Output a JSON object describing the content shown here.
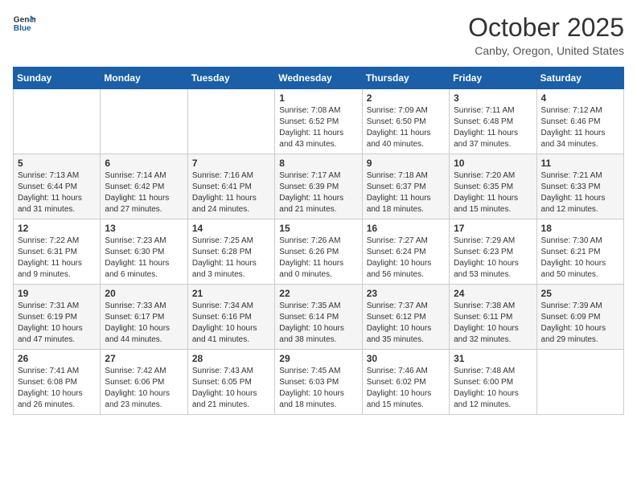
{
  "header": {
    "logo_general": "General",
    "logo_blue": "Blue",
    "title": "October 2025",
    "location": "Canby, Oregon, United States"
  },
  "weekdays": [
    "Sunday",
    "Monday",
    "Tuesday",
    "Wednesday",
    "Thursday",
    "Friday",
    "Saturday"
  ],
  "weeks": [
    [
      {
        "day": "",
        "info": ""
      },
      {
        "day": "",
        "info": ""
      },
      {
        "day": "",
        "info": ""
      },
      {
        "day": "1",
        "info": "Sunrise: 7:08 AM\nSunset: 6:52 PM\nDaylight: 11 hours\nand 43 minutes."
      },
      {
        "day": "2",
        "info": "Sunrise: 7:09 AM\nSunset: 6:50 PM\nDaylight: 11 hours\nand 40 minutes."
      },
      {
        "day": "3",
        "info": "Sunrise: 7:11 AM\nSunset: 6:48 PM\nDaylight: 11 hours\nand 37 minutes."
      },
      {
        "day": "4",
        "info": "Sunrise: 7:12 AM\nSunset: 6:46 PM\nDaylight: 11 hours\nand 34 minutes."
      }
    ],
    [
      {
        "day": "5",
        "info": "Sunrise: 7:13 AM\nSunset: 6:44 PM\nDaylight: 11 hours\nand 31 minutes."
      },
      {
        "day": "6",
        "info": "Sunrise: 7:14 AM\nSunset: 6:42 PM\nDaylight: 11 hours\nand 27 minutes."
      },
      {
        "day": "7",
        "info": "Sunrise: 7:16 AM\nSunset: 6:41 PM\nDaylight: 11 hours\nand 24 minutes."
      },
      {
        "day": "8",
        "info": "Sunrise: 7:17 AM\nSunset: 6:39 PM\nDaylight: 11 hours\nand 21 minutes."
      },
      {
        "day": "9",
        "info": "Sunrise: 7:18 AM\nSunset: 6:37 PM\nDaylight: 11 hours\nand 18 minutes."
      },
      {
        "day": "10",
        "info": "Sunrise: 7:20 AM\nSunset: 6:35 PM\nDaylight: 11 hours\nand 15 minutes."
      },
      {
        "day": "11",
        "info": "Sunrise: 7:21 AM\nSunset: 6:33 PM\nDaylight: 11 hours\nand 12 minutes."
      }
    ],
    [
      {
        "day": "12",
        "info": "Sunrise: 7:22 AM\nSunset: 6:31 PM\nDaylight: 11 hours\nand 9 minutes."
      },
      {
        "day": "13",
        "info": "Sunrise: 7:23 AM\nSunset: 6:30 PM\nDaylight: 11 hours\nand 6 minutes."
      },
      {
        "day": "14",
        "info": "Sunrise: 7:25 AM\nSunset: 6:28 PM\nDaylight: 11 hours\nand 3 minutes."
      },
      {
        "day": "15",
        "info": "Sunrise: 7:26 AM\nSunset: 6:26 PM\nDaylight: 11 hours\nand 0 minutes."
      },
      {
        "day": "16",
        "info": "Sunrise: 7:27 AM\nSunset: 6:24 PM\nDaylight: 10 hours\nand 56 minutes."
      },
      {
        "day": "17",
        "info": "Sunrise: 7:29 AM\nSunset: 6:23 PM\nDaylight: 10 hours\nand 53 minutes."
      },
      {
        "day": "18",
        "info": "Sunrise: 7:30 AM\nSunset: 6:21 PM\nDaylight: 10 hours\nand 50 minutes."
      }
    ],
    [
      {
        "day": "19",
        "info": "Sunrise: 7:31 AM\nSunset: 6:19 PM\nDaylight: 10 hours\nand 47 minutes."
      },
      {
        "day": "20",
        "info": "Sunrise: 7:33 AM\nSunset: 6:17 PM\nDaylight: 10 hours\nand 44 minutes."
      },
      {
        "day": "21",
        "info": "Sunrise: 7:34 AM\nSunset: 6:16 PM\nDaylight: 10 hours\nand 41 minutes."
      },
      {
        "day": "22",
        "info": "Sunrise: 7:35 AM\nSunset: 6:14 PM\nDaylight: 10 hours\nand 38 minutes."
      },
      {
        "day": "23",
        "info": "Sunrise: 7:37 AM\nSunset: 6:12 PM\nDaylight: 10 hours\nand 35 minutes."
      },
      {
        "day": "24",
        "info": "Sunrise: 7:38 AM\nSunset: 6:11 PM\nDaylight: 10 hours\nand 32 minutes."
      },
      {
        "day": "25",
        "info": "Sunrise: 7:39 AM\nSunset: 6:09 PM\nDaylight: 10 hours\nand 29 minutes."
      }
    ],
    [
      {
        "day": "26",
        "info": "Sunrise: 7:41 AM\nSunset: 6:08 PM\nDaylight: 10 hours\nand 26 minutes."
      },
      {
        "day": "27",
        "info": "Sunrise: 7:42 AM\nSunset: 6:06 PM\nDaylight: 10 hours\nand 23 minutes."
      },
      {
        "day": "28",
        "info": "Sunrise: 7:43 AM\nSunset: 6:05 PM\nDaylight: 10 hours\nand 21 minutes."
      },
      {
        "day": "29",
        "info": "Sunrise: 7:45 AM\nSunset: 6:03 PM\nDaylight: 10 hours\nand 18 minutes."
      },
      {
        "day": "30",
        "info": "Sunrise: 7:46 AM\nSunset: 6:02 PM\nDaylight: 10 hours\nand 15 minutes."
      },
      {
        "day": "31",
        "info": "Sunrise: 7:48 AM\nSunset: 6:00 PM\nDaylight: 10 hours\nand 12 minutes."
      },
      {
        "day": "",
        "info": ""
      }
    ]
  ]
}
